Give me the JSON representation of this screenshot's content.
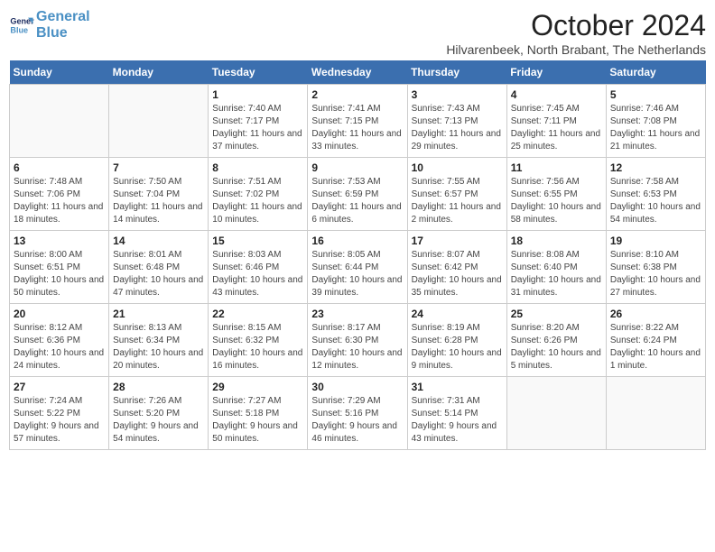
{
  "header": {
    "logo_line1": "General",
    "logo_line2": "Blue",
    "month": "October 2024",
    "location": "Hilvarenbeek, North Brabant, The Netherlands"
  },
  "weekdays": [
    "Sunday",
    "Monday",
    "Tuesday",
    "Wednesday",
    "Thursday",
    "Friday",
    "Saturday"
  ],
  "weeks": [
    [
      {
        "day": "",
        "info": ""
      },
      {
        "day": "",
        "info": ""
      },
      {
        "day": "1",
        "info": "Sunrise: 7:40 AM\nSunset: 7:17 PM\nDaylight: 11 hours and 37 minutes."
      },
      {
        "day": "2",
        "info": "Sunrise: 7:41 AM\nSunset: 7:15 PM\nDaylight: 11 hours and 33 minutes."
      },
      {
        "day": "3",
        "info": "Sunrise: 7:43 AM\nSunset: 7:13 PM\nDaylight: 11 hours and 29 minutes."
      },
      {
        "day": "4",
        "info": "Sunrise: 7:45 AM\nSunset: 7:11 PM\nDaylight: 11 hours and 25 minutes."
      },
      {
        "day": "5",
        "info": "Sunrise: 7:46 AM\nSunset: 7:08 PM\nDaylight: 11 hours and 21 minutes."
      }
    ],
    [
      {
        "day": "6",
        "info": "Sunrise: 7:48 AM\nSunset: 7:06 PM\nDaylight: 11 hours and 18 minutes."
      },
      {
        "day": "7",
        "info": "Sunrise: 7:50 AM\nSunset: 7:04 PM\nDaylight: 11 hours and 14 minutes."
      },
      {
        "day": "8",
        "info": "Sunrise: 7:51 AM\nSunset: 7:02 PM\nDaylight: 11 hours and 10 minutes."
      },
      {
        "day": "9",
        "info": "Sunrise: 7:53 AM\nSunset: 6:59 PM\nDaylight: 11 hours and 6 minutes."
      },
      {
        "day": "10",
        "info": "Sunrise: 7:55 AM\nSunset: 6:57 PM\nDaylight: 11 hours and 2 minutes."
      },
      {
        "day": "11",
        "info": "Sunrise: 7:56 AM\nSunset: 6:55 PM\nDaylight: 10 hours and 58 minutes."
      },
      {
        "day": "12",
        "info": "Sunrise: 7:58 AM\nSunset: 6:53 PM\nDaylight: 10 hours and 54 minutes."
      }
    ],
    [
      {
        "day": "13",
        "info": "Sunrise: 8:00 AM\nSunset: 6:51 PM\nDaylight: 10 hours and 50 minutes."
      },
      {
        "day": "14",
        "info": "Sunrise: 8:01 AM\nSunset: 6:48 PM\nDaylight: 10 hours and 47 minutes."
      },
      {
        "day": "15",
        "info": "Sunrise: 8:03 AM\nSunset: 6:46 PM\nDaylight: 10 hours and 43 minutes."
      },
      {
        "day": "16",
        "info": "Sunrise: 8:05 AM\nSunset: 6:44 PM\nDaylight: 10 hours and 39 minutes."
      },
      {
        "day": "17",
        "info": "Sunrise: 8:07 AM\nSunset: 6:42 PM\nDaylight: 10 hours and 35 minutes."
      },
      {
        "day": "18",
        "info": "Sunrise: 8:08 AM\nSunset: 6:40 PM\nDaylight: 10 hours and 31 minutes."
      },
      {
        "day": "19",
        "info": "Sunrise: 8:10 AM\nSunset: 6:38 PM\nDaylight: 10 hours and 27 minutes."
      }
    ],
    [
      {
        "day": "20",
        "info": "Sunrise: 8:12 AM\nSunset: 6:36 PM\nDaylight: 10 hours and 24 minutes."
      },
      {
        "day": "21",
        "info": "Sunrise: 8:13 AM\nSunset: 6:34 PM\nDaylight: 10 hours and 20 minutes."
      },
      {
        "day": "22",
        "info": "Sunrise: 8:15 AM\nSunset: 6:32 PM\nDaylight: 10 hours and 16 minutes."
      },
      {
        "day": "23",
        "info": "Sunrise: 8:17 AM\nSunset: 6:30 PM\nDaylight: 10 hours and 12 minutes."
      },
      {
        "day": "24",
        "info": "Sunrise: 8:19 AM\nSunset: 6:28 PM\nDaylight: 10 hours and 9 minutes."
      },
      {
        "day": "25",
        "info": "Sunrise: 8:20 AM\nSunset: 6:26 PM\nDaylight: 10 hours and 5 minutes."
      },
      {
        "day": "26",
        "info": "Sunrise: 8:22 AM\nSunset: 6:24 PM\nDaylight: 10 hours and 1 minute."
      }
    ],
    [
      {
        "day": "27",
        "info": "Sunrise: 7:24 AM\nSunset: 5:22 PM\nDaylight: 9 hours and 57 minutes."
      },
      {
        "day": "28",
        "info": "Sunrise: 7:26 AM\nSunset: 5:20 PM\nDaylight: 9 hours and 54 minutes."
      },
      {
        "day": "29",
        "info": "Sunrise: 7:27 AM\nSunset: 5:18 PM\nDaylight: 9 hours and 50 minutes."
      },
      {
        "day": "30",
        "info": "Sunrise: 7:29 AM\nSunset: 5:16 PM\nDaylight: 9 hours and 46 minutes."
      },
      {
        "day": "31",
        "info": "Sunrise: 7:31 AM\nSunset: 5:14 PM\nDaylight: 9 hours and 43 minutes."
      },
      {
        "day": "",
        "info": ""
      },
      {
        "day": "",
        "info": ""
      }
    ]
  ]
}
